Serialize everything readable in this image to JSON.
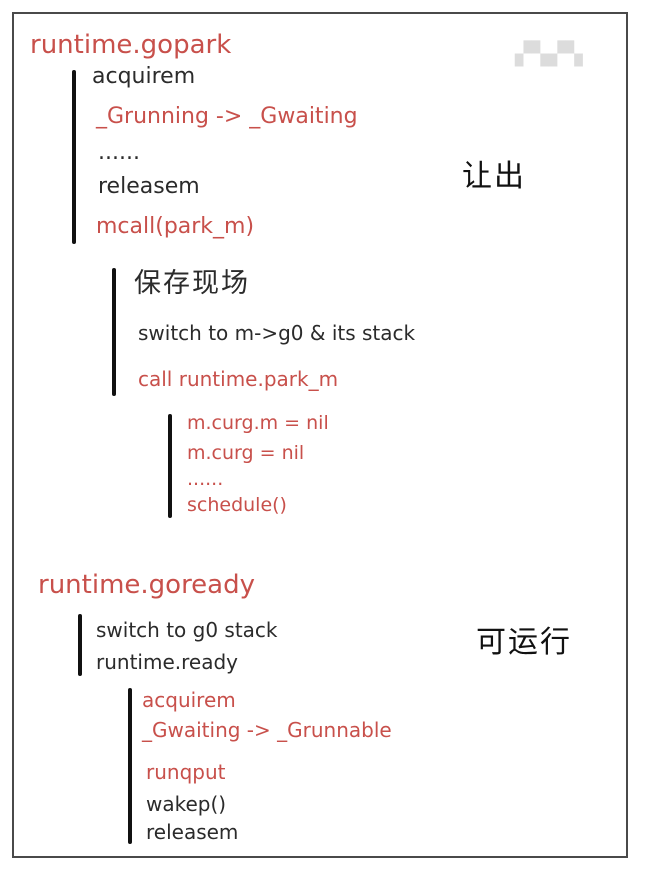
{
  "section_park": {
    "title": "runtime.gopark",
    "label": "让出",
    "lines": [
      "acquirem",
      "_Grunning -> _Gwaiting",
      "......",
      "releasem",
      "mcall(park_m)"
    ],
    "mcall": {
      "heading": "保存现场",
      "lines": [
        "switch to m->g0 & its stack",
        "call runtime.park_m"
      ],
      "park_m": {
        "lines": [
          "m.curg.m = nil",
          "m.curg = nil",
          "......",
          "schedule()"
        ]
      }
    }
  },
  "section_ready": {
    "title": "runtime.goready",
    "label": "可运行",
    "lines": [
      "switch to g0 stack",
      "runtime.ready"
    ],
    "ready": {
      "lines": [
        "acquirem",
        "_Gwaiting -> _Grunnable",
        "runqput",
        "wakep()",
        "releasem"
      ]
    }
  },
  "colors": {
    "highlight": "#c8504b",
    "text": "#2b2b2b",
    "bar": "#111111"
  }
}
